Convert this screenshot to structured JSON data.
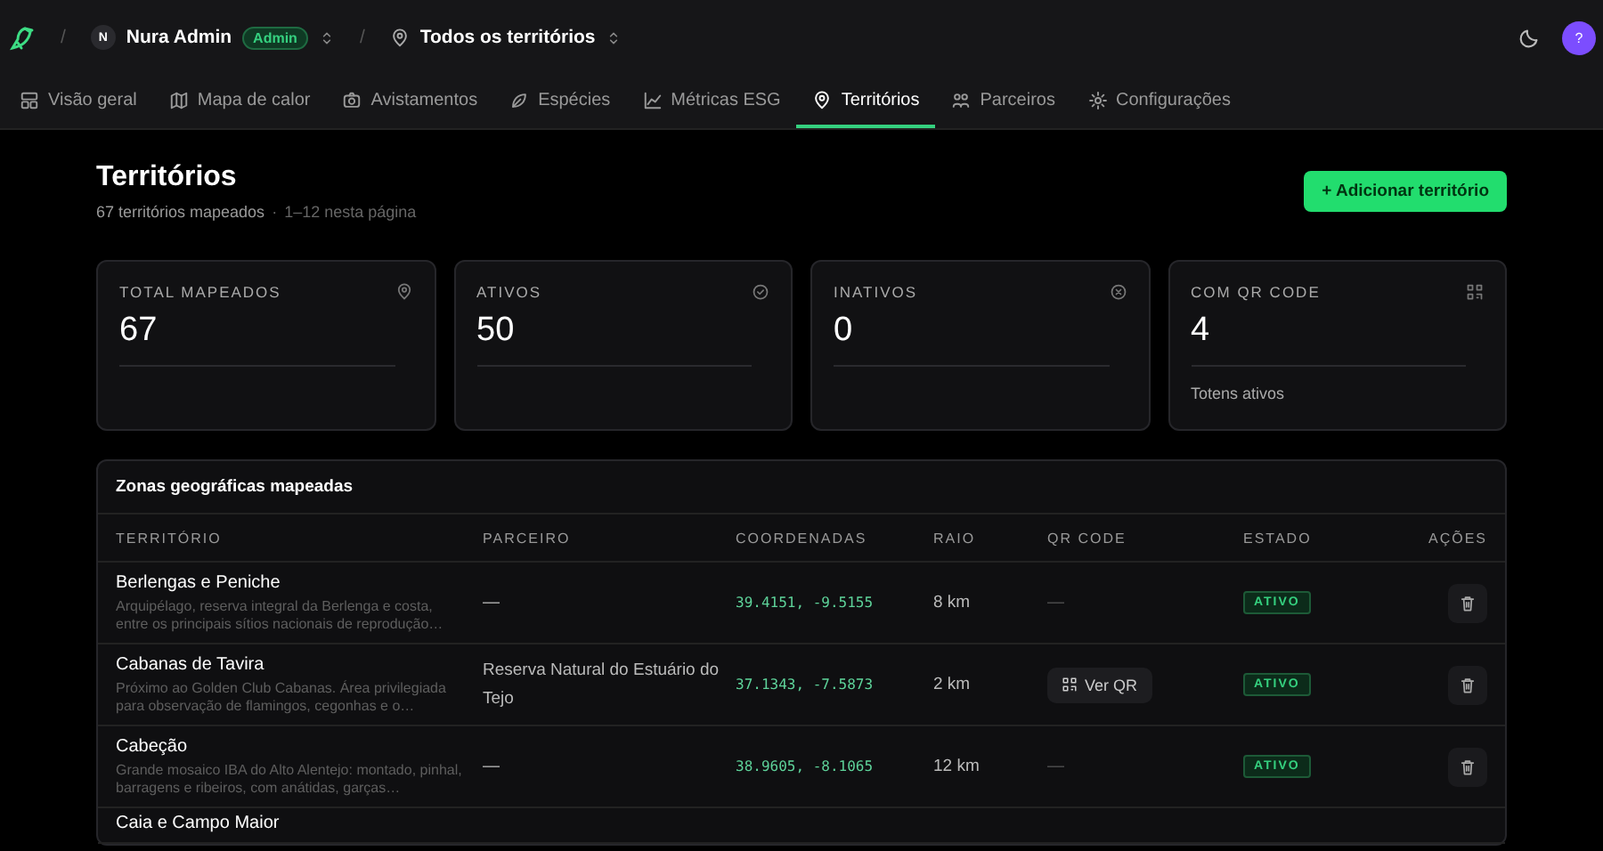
{
  "topbar": {
    "separators": [
      "/",
      "/"
    ],
    "org_initial": "N",
    "org_name": "Nura Admin",
    "role_badge": "Admin",
    "territory_selector": "Todos os territórios",
    "avatar": "?"
  },
  "tabs": [
    {
      "label": "Visão geral",
      "selected": false
    },
    {
      "label": "Mapa de calor",
      "selected": false
    },
    {
      "label": "Avistamentos",
      "selected": false
    },
    {
      "label": "Espécies",
      "selected": false
    },
    {
      "label": "Métricas ESG",
      "selected": false
    },
    {
      "label": "Territórios",
      "selected": true
    },
    {
      "label": "Parceiros",
      "selected": false
    },
    {
      "label": "Configurações",
      "selected": false
    }
  ],
  "page": {
    "title": "Territórios",
    "subtitle": "67 territórios mapeados",
    "subtitle_separator": "·",
    "page_range": "1–12 nesta página",
    "add_button": "+ Adicionar território"
  },
  "stats": [
    {
      "label": "TOTAL MAPEADOS",
      "value": "67"
    },
    {
      "label": "ATIVOS",
      "value": "50"
    },
    {
      "label": "INATIVOS",
      "value": "0"
    },
    {
      "label": "COM QR CODE",
      "value": "4",
      "note": "Totens ativos"
    }
  ],
  "table": {
    "title": "Zonas geográficas mapeadas",
    "columns": [
      "TERRITÓRIO",
      "PARCEIRO",
      "COORDENADAS",
      "RAIO",
      "QR CODE",
      "ESTADO",
      "AÇÕES"
    ],
    "rows": [
      {
        "name": "Berlengas e Peniche",
        "description": "Arquipélago, reserva integral da Berlenga e costa, entre os principais sítios nacionais de reprodução…",
        "partner": "—",
        "coordinates": "39.4151, -9.5155",
        "radius": "8 km",
        "qr": {
          "kind": "dash",
          "text": "—"
        },
        "status": "ATIVO"
      },
      {
        "name": "Cabanas de Tavira",
        "description": "Próximo ao Golden Club Cabanas. Área privilegiada para observação de flamingos, cegonhas e o…",
        "partner": "Reserva Natural do Estuário do Tejo",
        "coordinates": "37.1343, -7.5873",
        "radius": "2 km",
        "qr": {
          "kind": "button",
          "text": "Ver QR"
        },
        "status": "ATIVO"
      },
      {
        "name": "Cabeção",
        "description": "Grande mosaico IBA do Alto Alentejo: montado, pinhal, barragens e ribeiros, com anátidas, garças…",
        "partner": "—",
        "coordinates": "38.9605, -8.1065",
        "radius": "12 km",
        "qr": {
          "kind": "dash",
          "text": "—"
        },
        "status": "ATIVO"
      },
      {
        "name": "Caia e Campo Maior"
      }
    ]
  }
}
